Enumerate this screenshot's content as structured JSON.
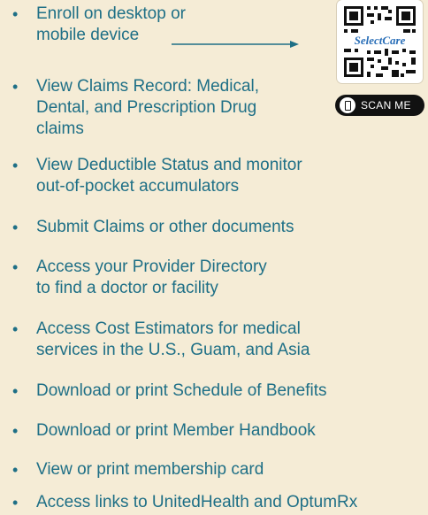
{
  "items": [
    {
      "lines": [
        "Enroll on desktop or",
        "mobile device"
      ]
    },
    {
      "lines": [
        "View Claims Record: Medical,",
        "Dental, and Prescription Drug",
        "claims"
      ]
    },
    {
      "lines": [
        "View Deductible Status and monitor",
        "out-of-pocket accumulators"
      ]
    },
    {
      "lines": [
        "Submit Claims or other documents"
      ]
    },
    {
      "lines": [
        "Access your Provider Directory",
        "to find a doctor or facility"
      ]
    },
    {
      "lines": [
        "Access Cost Estimators for medical",
        "services in the U.S., Guam, and Asia"
      ]
    },
    {
      "lines": [
        "Download or print Schedule of Benefits"
      ]
    },
    {
      "lines": [
        "Download or print Member Handbook"
      ]
    },
    {
      "lines": [
        "View or print membership card"
      ]
    },
    {
      "lines": [
        "Access links to UnitedHealth and OptumRx"
      ]
    }
  ],
  "bullet": "•",
  "qr": {
    "logo_text": "SelectCare",
    "button_label": "SCAN ME"
  },
  "colors": {
    "text": "#1e6f86",
    "background": "#f5ecd6",
    "qr_logo": "#2a6fb8"
  }
}
